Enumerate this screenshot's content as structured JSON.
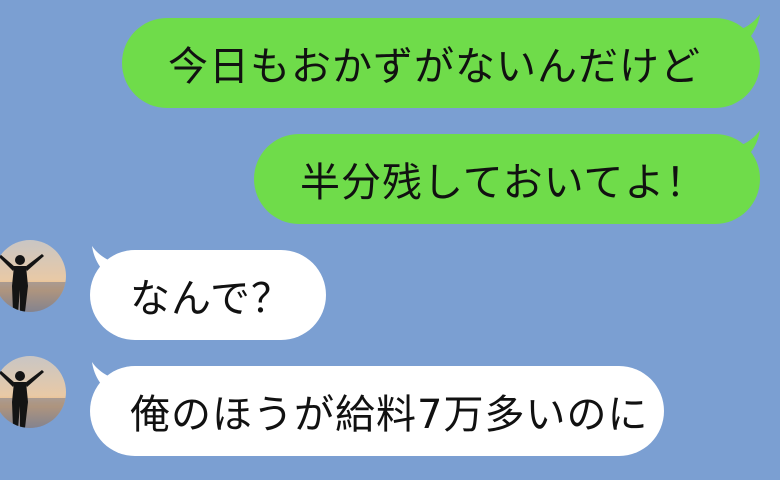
{
  "colors": {
    "background": "#7b9fd2",
    "sent_bubble": "#6fdc4a",
    "received_bubble": "#ffffff",
    "text": "#111111"
  },
  "messages": [
    {
      "sender": "self",
      "text": "今日もおかずがないんだけど"
    },
    {
      "sender": "self",
      "text": "半分残しておいてよ！"
    },
    {
      "sender": "other",
      "text": "なんで？",
      "avatar": "sunset-silhouette-avatar"
    },
    {
      "sender": "other",
      "text": "俺のほうが給料7万多いのに",
      "avatar": "sunset-silhouette-avatar"
    }
  ]
}
